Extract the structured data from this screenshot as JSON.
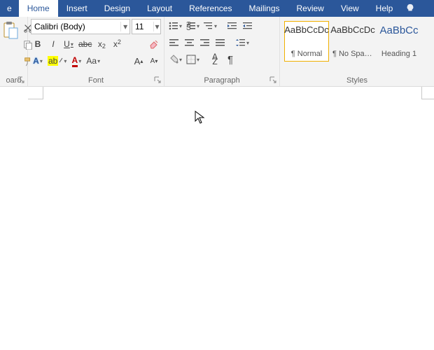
{
  "tabs": {
    "file_partial": "e",
    "home": "Home",
    "insert": "Insert",
    "design": "Design",
    "layout": "Layout",
    "references": "References",
    "mailings": "Mailings",
    "review": "Review",
    "view": "View",
    "help": "Help"
  },
  "clipboard": {
    "label": "oard"
  },
  "font": {
    "label": "Font",
    "name": "Calibri (Body)",
    "size": "11",
    "bold": "B",
    "italic": "I",
    "underline": "U",
    "strike": "abc",
    "sub_x": "x",
    "sub_2": "2",
    "sup_x": "x",
    "sup_2": "2",
    "text_effects": "A",
    "highlight": "ab",
    "font_color": "A",
    "change_case": "Aa",
    "grow": "A",
    "shrink": "A"
  },
  "paragraph": {
    "label": "Paragraph",
    "sort": "A",
    "sort_z": "Z",
    "pilcrow": "¶"
  },
  "styles": {
    "label": "Styles",
    "items": [
      {
        "preview": "AaBbCcDc",
        "name": "¶ Normal"
      },
      {
        "preview": "AaBbCcDc",
        "name": "¶ No Spac..."
      },
      {
        "preview": "AaBbCc",
        "name": "Heading 1"
      }
    ]
  }
}
